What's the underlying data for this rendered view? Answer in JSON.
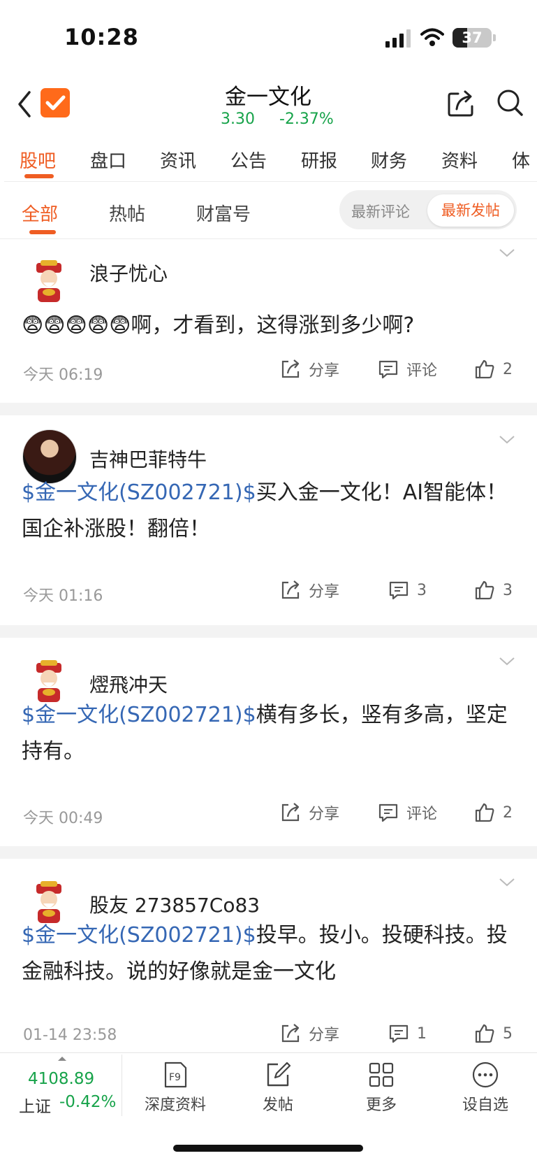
{
  "status_bar": {
    "time": "10:28",
    "battery": "37"
  },
  "header": {
    "title": "金一文化",
    "price": "3.30",
    "change_pct": "-2.37%"
  },
  "tabs": [
    "股吧",
    "盘口",
    "资讯",
    "公告",
    "研报",
    "财务",
    "资料",
    "体"
  ],
  "subtabs": [
    "全部",
    "热帖",
    "财富号"
  ],
  "sort": {
    "left": "最新评论",
    "right": "最新发帖"
  },
  "posts": [
    {
      "user": "浪子忧心",
      "stock_tag": "",
      "text": "啊，才看到，这得涨到多少啊?",
      "emoji_count": 5,
      "time": "今天 06:19",
      "share": "分享",
      "comment": "评论",
      "likes": "2"
    },
    {
      "user": "吉神巴菲特牛",
      "stock_tag": "$金一文化(SZ002721)$",
      "text": "买入金一文化！AI智能体！国企补涨股！翻倍！",
      "time": "今天 01:16",
      "share": "分享",
      "comment": "3",
      "likes": "3"
    },
    {
      "user": "熤飛冲天",
      "stock_tag": "$金一文化(SZ002721)$",
      "text": "横有多长，竖有多高，坚定持有。",
      "time": "今天 00:49",
      "share": "分享",
      "comment": "评论",
      "likes": "2"
    },
    {
      "user": "股友 273857Co83",
      "stock_tag": "$金一文化(SZ002721)$",
      "text": "投早。投小。投硬科技。投金融科技。说的好像就是金一文化",
      "time": "01-14 23:58",
      "share": "分享",
      "comment": "1",
      "likes": "5"
    }
  ],
  "bottom": {
    "index_value": "4108.89",
    "index_name": "上证",
    "index_pct": "-0.42%",
    "items": [
      "深度资料",
      "发帖",
      "更多",
      "设自选"
    ],
    "f9": "F9"
  },
  "colors": {
    "accent": "#ef5d23",
    "down_green": "#17a34a",
    "stock_link": "#3567b4"
  }
}
